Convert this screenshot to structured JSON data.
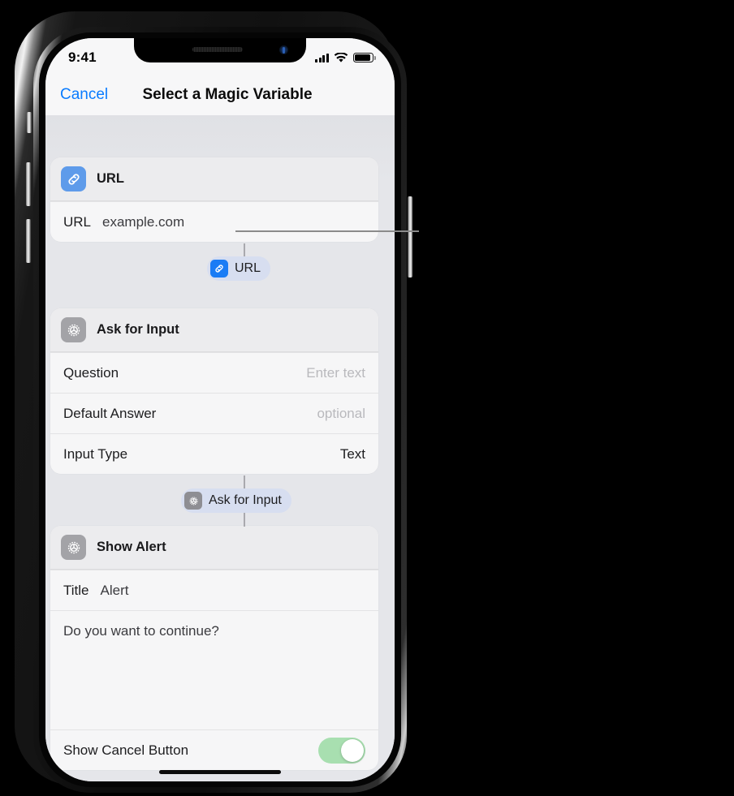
{
  "status_bar": {
    "time": "9:41",
    "signal_icon": "cellular-bars-icon",
    "wifi_icon": "wifi-icon",
    "battery_icon": "battery-icon"
  },
  "nav": {
    "cancel_label": "Cancel",
    "title": "Select a Magic Variable"
  },
  "actions": [
    {
      "id": "url",
      "header_icon": "link-icon",
      "header_icon_color": "#5e9bea",
      "header_title": "URL",
      "rows": [
        {
          "label": "URL",
          "value": "example.com",
          "value_is_placeholder": true,
          "align": "left"
        }
      ]
    },
    {
      "id": "ask-for-input",
      "header_icon": "gear-icon",
      "header_icon_color": "#a3a3a7",
      "header_title": "Ask for Input",
      "rows": [
        {
          "label": "Question",
          "value": "Enter text",
          "value_is_placeholder": true,
          "align": "right"
        },
        {
          "label": "Default Answer",
          "value": "optional",
          "value_is_placeholder": true,
          "align": "right"
        },
        {
          "label": "Input Type",
          "value": "Text",
          "value_is_placeholder": false,
          "align": "right"
        }
      ]
    },
    {
      "id": "show-alert",
      "header_icon": "gear-icon",
      "header_icon_color": "#a3a3a7",
      "header_title": "Show Alert",
      "title_row": {
        "label": "Title",
        "value": "Alert"
      },
      "message": "Do you want to continue?",
      "toggle_row": {
        "label": "Show Cancel Button",
        "state": "on",
        "on_color": "#a8dfb0"
      }
    }
  ],
  "variable_pills": [
    {
      "id": "url-pill",
      "icon": "link-icon",
      "icon_color": "#1a7cf5",
      "label": "URL"
    },
    {
      "id": "ask-for-input-pill",
      "icon": "gear-icon",
      "icon_color": "#8e8e93",
      "label": "Ask for Input"
    }
  ],
  "colors": {
    "accent_blue": "#0a7cff",
    "screen_background": "#e5e6ea",
    "card_background": "#f6f6f7",
    "card_header_background": "#ececee",
    "pill_background": "#d7def0",
    "callout_line": "#8b8b8b"
  }
}
